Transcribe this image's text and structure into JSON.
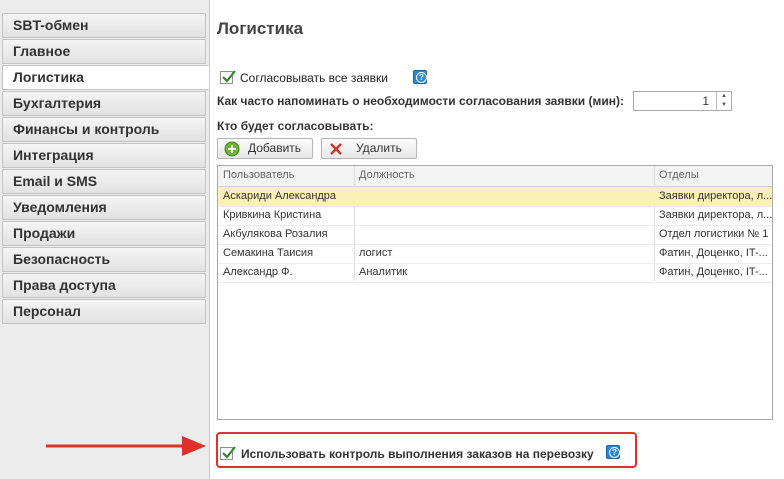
{
  "sidebar": {
    "items": [
      {
        "label": "SBT-обмен"
      },
      {
        "label": "Главное"
      },
      {
        "label": "Логистика"
      },
      {
        "label": "Бухгалтерия"
      },
      {
        "label": "Финансы и контроль"
      },
      {
        "label": "Интеграция"
      },
      {
        "label": "Email и SMS"
      },
      {
        "label": "Уведомления"
      },
      {
        "label": "Продажи"
      },
      {
        "label": "Безопасность"
      },
      {
        "label": "Права доступа"
      },
      {
        "label": "Персонал"
      }
    ],
    "active": "Логистика"
  },
  "main": {
    "title": "Логистика",
    "approve_all_label": "Согласовывать все заявки",
    "approve_all_checked": true,
    "remind_label": "Как часто напоминать о необходимости согласования заявки (мин):",
    "remind_value": "1",
    "who_label": "Кто будет согласовывать:",
    "add_button": "Добавить",
    "delete_button": "Удалить",
    "table": {
      "columns": [
        "Пользователь",
        "Должность",
        "Отделы"
      ],
      "rows": [
        [
          "Аскариди Александра",
          "",
          "Заявки директора, л..."
        ],
        [
          "Кривкина Кристина",
          "",
          "Заявки директора, л..."
        ],
        [
          "Акбулякова Розалия",
          "",
          "Отдел логистики № 1"
        ],
        [
          "Семакина Таисия",
          "логист",
          "Фатин, Доценко, IT-..."
        ],
        [
          "Александр Ф.",
          "Аналитик",
          "Фатин, Доценко, IT-..."
        ]
      ],
      "selected_row": 0
    },
    "use_control_label": "Использовать контроль выполнения заказов на перевозку",
    "use_control_checked": true,
    "help_icon": "?"
  },
  "colors": {
    "accent_red": "#e0302a",
    "selection": "#fbf0b5",
    "help_blue": "#2b88d8",
    "check_green": "#2e8b2e"
  },
  "icons": {
    "help": "question-icon",
    "add": "plus-circle-icon",
    "delete": "red-x-icon",
    "check": "checkmark-icon",
    "arrow": "red-arrow-icon"
  }
}
